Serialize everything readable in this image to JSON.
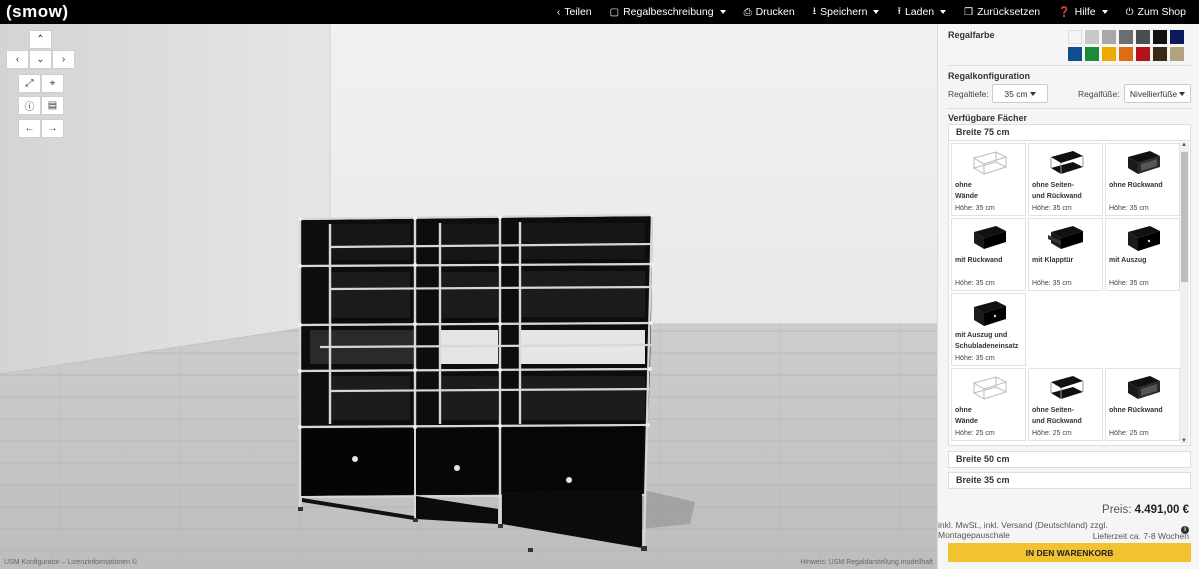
{
  "header": {
    "logo": "(smow)",
    "nav": [
      {
        "label": "Teilen",
        "icon": "share-icon",
        "glyph": "‹",
        "dropdown": false
      },
      {
        "label": "Regalbeschreibung",
        "icon": "description-icon",
        "glyph": "▢",
        "dropdown": true
      },
      {
        "label": "Drucken",
        "icon": "print-icon",
        "glyph": "⎙",
        "dropdown": false
      },
      {
        "label": "Speichern",
        "icon": "download-icon",
        "glyph": "⭳",
        "dropdown": true
      },
      {
        "label": "Laden",
        "icon": "upload-icon",
        "glyph": "⭱",
        "dropdown": true
      },
      {
        "label": "Zurücksetzen",
        "icon": "trash-icon",
        "glyph": "❒",
        "dropdown": false
      },
      {
        "label": "Hilfe",
        "icon": "question-icon",
        "glyph": "❓",
        "dropdown": true
      },
      {
        "label": "Zum Shop",
        "icon": "power-icon",
        "glyph": "⏻",
        "dropdown": false
      }
    ]
  },
  "viewport": {
    "controls": {
      "up": "⌃",
      "left": "‹",
      "down": "⌄",
      "right": "›",
      "expand": "⤢",
      "center": "⌖",
      "info": "ⓘ",
      "folder": "▤",
      "undo": "←",
      "redo": "→"
    },
    "footer_left": "USM Konfigurator – Lizenzinformationen ©",
    "footer_right": "Hinweis: USM Regaldarstellung modellhaft"
  },
  "panel": {
    "regalfarbe_title": "Regalfarbe",
    "colors": [
      {
        "name": "reinweiss",
        "hex": "#f5f5f5"
      },
      {
        "name": "lichtgrau",
        "hex": "#c8c8c8"
      },
      {
        "name": "mittelgrau",
        "hex": "#a8a8a8"
      },
      {
        "name": "anthrazitgrau",
        "hex": "#6a6e73"
      },
      {
        "name": "dunkelgrau",
        "hex": "#4a4d52"
      },
      {
        "name": "schwarz",
        "hex": "#111111"
      },
      {
        "name": "stahlblau",
        "hex": "#0b1a5c"
      },
      {
        "name": "enzianblau",
        "hex": "#0f4f8f"
      },
      {
        "name": "gruen",
        "hex": "#1b8a3a"
      },
      {
        "name": "gelb",
        "hex": "#f1a800"
      },
      {
        "name": "orange",
        "hex": "#e06b10"
      },
      {
        "name": "rot",
        "hex": "#b3121c"
      },
      {
        "name": "braun",
        "hex": "#3b2a18"
      },
      {
        "name": "beige",
        "hex": "#b3a27e"
      }
    ],
    "regalkonfiguration_title": "Regalkonfiguration",
    "regaltiefe_label": "Regaltiefe:",
    "regaltiefe_value": "35 cm",
    "regalfuesse_label": "Regalfüße:",
    "regalfuesse_value": "Nivellierfüße",
    "faecher_title": "Verfügbare Fächer",
    "sections": [
      {
        "label": "Breite 75 cm"
      },
      {
        "label": "Breite 50 cm"
      },
      {
        "label": "Breite 35 cm"
      }
    ],
    "tiles": [
      {
        "name1": "ohne",
        "name2": "Wände",
        "height": "Höhe: 35 cm",
        "style": "wire"
      },
      {
        "name1": "ohne Seiten-",
        "name2": "und Rückwand",
        "height": "Höhe: 35 cm",
        "style": "open"
      },
      {
        "name1": "ohne Rückwand",
        "name2": "",
        "height": "Höhe: 35 cm",
        "style": "box-open"
      },
      {
        "name1": "mit Rückwand",
        "name2": "",
        "height": "Höhe: 35 cm",
        "style": "box"
      },
      {
        "name1": "mit Klapptür",
        "name2": "",
        "height": "Höhe: 35 cm",
        "style": "flap"
      },
      {
        "name1": "mit Auszug",
        "name2": "",
        "height": "Höhe: 35 cm",
        "style": "drawer"
      },
      {
        "name1": "mit Auszug und",
        "name2": "Schubladeneinsatz",
        "height": "Höhe: 35 cm",
        "style": "drawer"
      },
      {
        "name1": "",
        "name2": "",
        "height": "",
        "style": "empty"
      },
      {
        "name1": "",
        "name2": "",
        "height": "",
        "style": "empty"
      },
      {
        "name1": "ohne",
        "name2": "Wände",
        "height": "Höhe: 25 cm",
        "style": "wire"
      },
      {
        "name1": "ohne Seiten-",
        "name2": "und Rückwand",
        "height": "Höhe: 25 cm",
        "style": "open"
      },
      {
        "name1": "ohne Rückwand",
        "name2": "",
        "height": "Höhe: 25 cm",
        "style": "box-open"
      }
    ],
    "price_label": "Preis:",
    "price_value": "4.491,00 €",
    "price_note": "inkl. MwSt., inkl. Versand (Deutschland) zzgl. Montagepauschale",
    "delivery": "Lieferzeit ca. 7-8 Wochen",
    "cart_button": "IN DEN WARENKORB"
  }
}
